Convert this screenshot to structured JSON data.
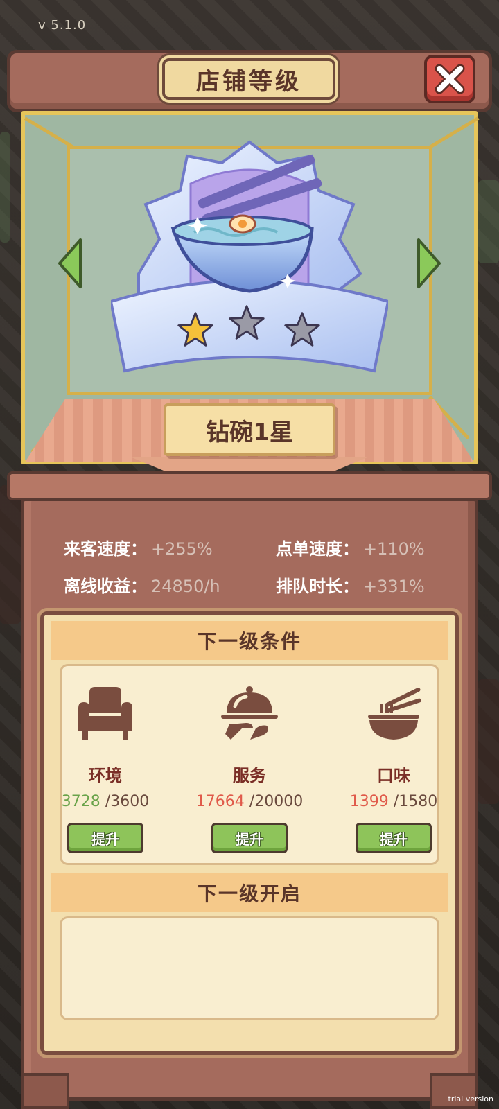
{
  "version": "v 5.1.0",
  "header": {
    "title": "店铺等级",
    "close_icon": "close-icon"
  },
  "showcase": {
    "badge_icon": "diamond-bowl-badge-icon",
    "stars_filled": 1,
    "stars_total": 3,
    "level_name": "钻碗1星",
    "nav_left_icon": "arrow-left-icon",
    "nav_right_icon": "arrow-right-icon"
  },
  "stats": [
    {
      "label": "来客速度：",
      "value": "+255%"
    },
    {
      "label": "点单速度：",
      "value": "+110%"
    },
    {
      "label": "离线收益：",
      "value": "24850/h"
    },
    {
      "label": "排队时长：",
      "value": "+331%"
    }
  ],
  "next_conditions": {
    "title": "下一级条件",
    "items": [
      {
        "icon": "armchair-icon",
        "label": "环境",
        "current": "3728",
        "required": "/3600",
        "met": true,
        "button": "提升"
      },
      {
        "icon": "serving-cloche-icon",
        "label": "服务",
        "current": "17664",
        "required": "/20000",
        "met": false,
        "button": "提升"
      },
      {
        "icon": "noodle-bowl-icon",
        "label": "口味",
        "current": "1399",
        "required": "/1580",
        "met": false,
        "button": "提升"
      }
    ]
  },
  "next_unlock": {
    "title": "下一级开启"
  },
  "colors": {
    "cabinet": "#a56b5d",
    "panel": "#f3dfae",
    "met": "#6aa34a",
    "unmet": "#e05a4a",
    "button_green": "#8ec45a"
  },
  "watermark": "trial version"
}
